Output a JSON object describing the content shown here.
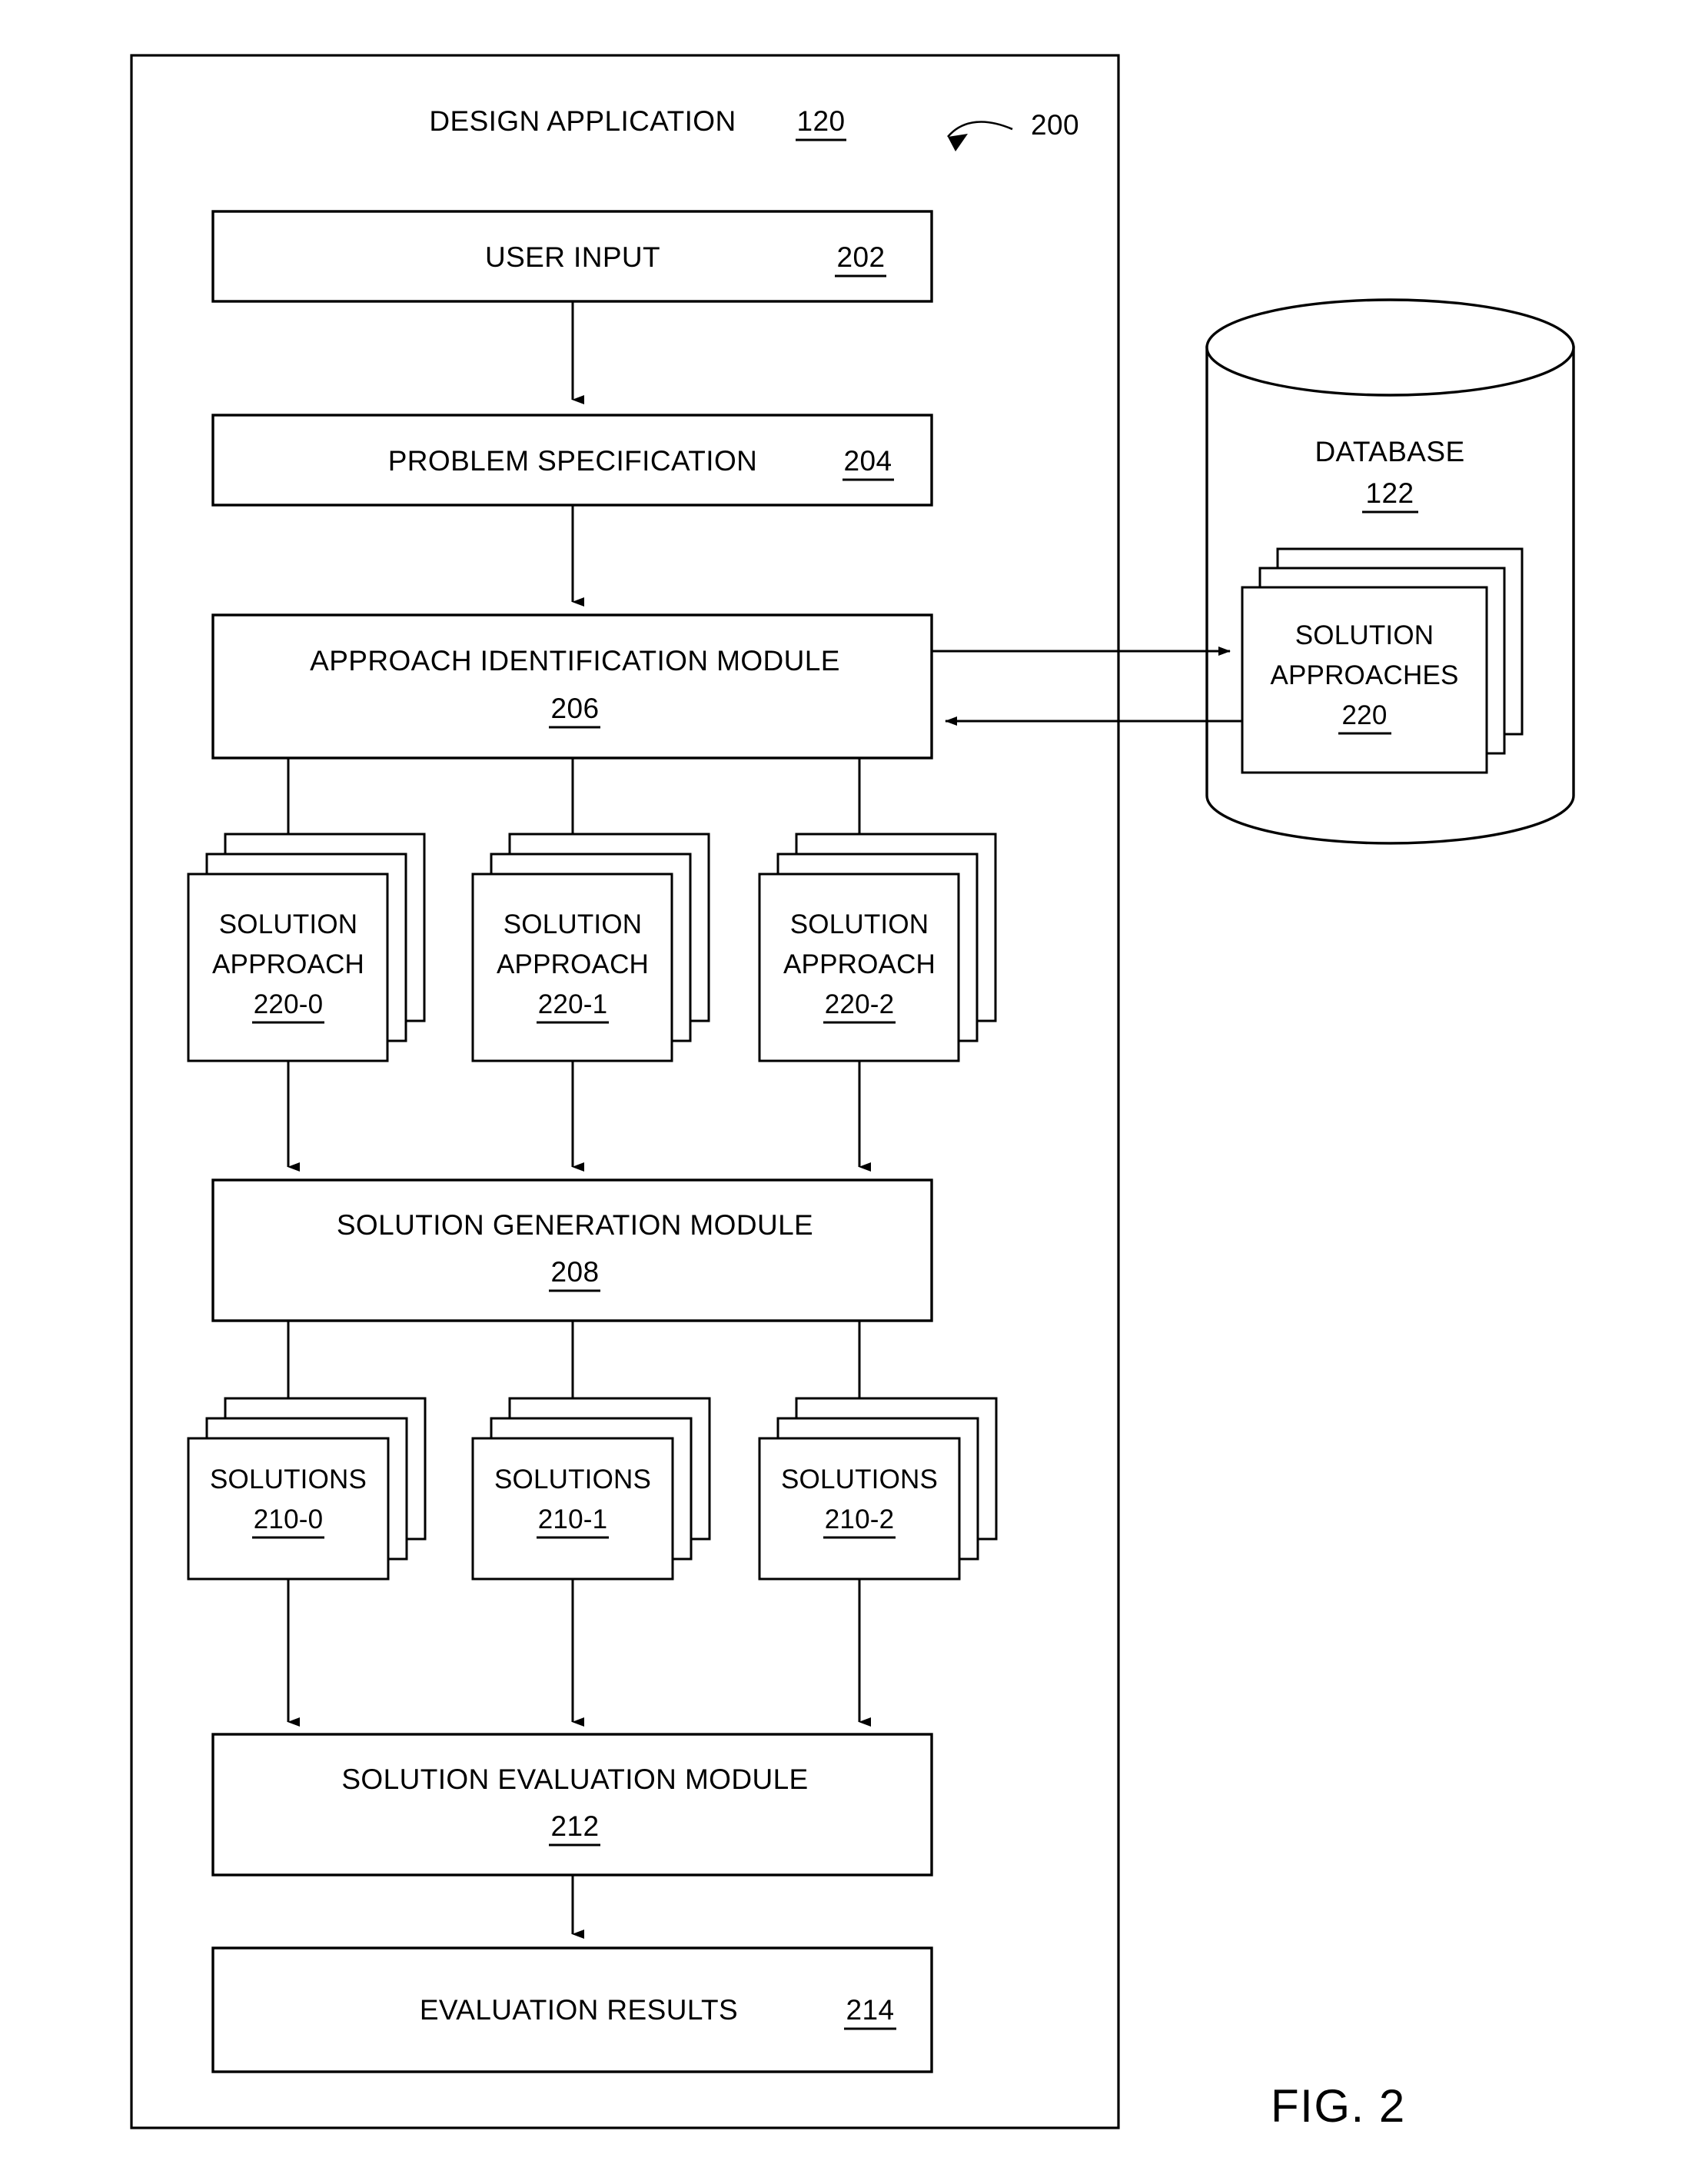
{
  "figure": {
    "caption": "FIG. 2",
    "diagram_label": "200"
  },
  "container": {
    "title": "DESIGN APPLICATION",
    "ref": "120"
  },
  "nodes": {
    "user_input": {
      "label": "USER INPUT",
      "ref": "202"
    },
    "problem_spec": {
      "label": "PROBLEM SPECIFICATION",
      "ref": "204"
    },
    "approach_module": {
      "label": "APPROACH IDENTIFICATION MODULE",
      "ref": "206"
    },
    "generation_module": {
      "label": "SOLUTION GENERATION MODULE",
      "ref": "208"
    },
    "evaluation_module": {
      "label": "SOLUTION EVALUATION MODULE",
      "ref": "212"
    },
    "evaluation_results": {
      "label": "EVALUATION RESULTS",
      "ref": "214"
    }
  },
  "database": {
    "label": "DATABASE",
    "ref": "122",
    "contents": {
      "line1": "SOLUTION",
      "line2": "APPROACHES",
      "ref": "220"
    }
  },
  "solution_approaches": [
    {
      "line1": "SOLUTION",
      "line2": "APPROACH",
      "ref": "220-0"
    },
    {
      "line1": "SOLUTION",
      "line2": "APPROACH",
      "ref": "220-1"
    },
    {
      "line1": "SOLUTION",
      "line2": "APPROACH",
      "ref": "220-2"
    }
  ],
  "solutions": [
    {
      "line1": "SOLUTIONS",
      "ref": "210-0"
    },
    {
      "line1": "SOLUTIONS",
      "ref": "210-1"
    },
    {
      "line1": "SOLUTIONS",
      "ref": "210-2"
    }
  ],
  "colors": {
    "stroke": "#000000",
    "background": "#ffffff"
  }
}
